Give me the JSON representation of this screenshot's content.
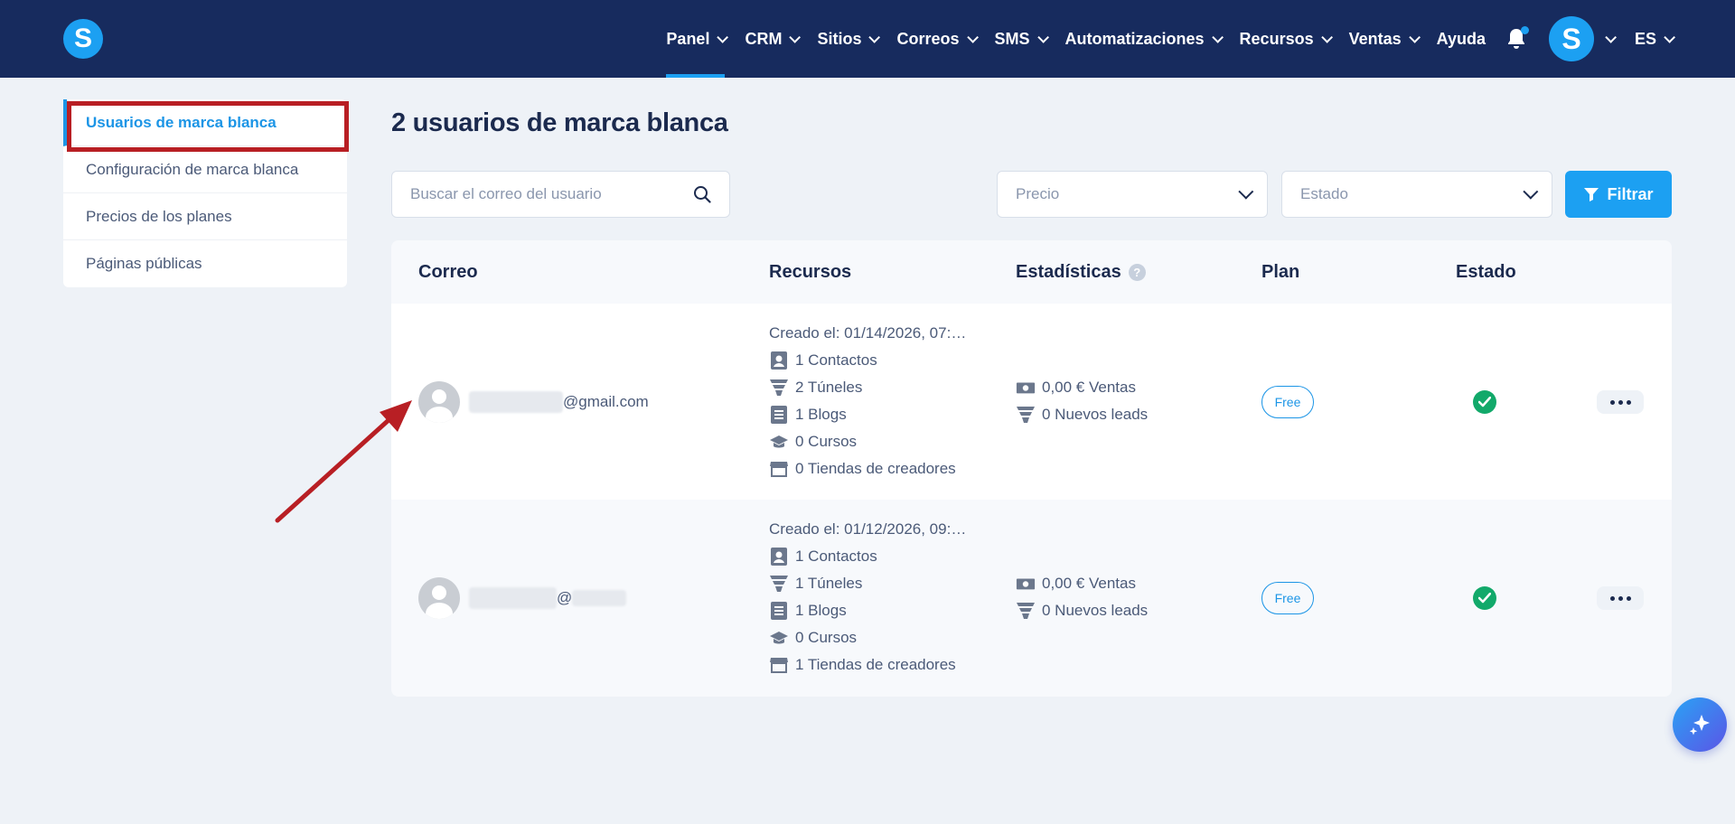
{
  "brand": {
    "logo_letter": "S",
    "accent": "#1ca0f2",
    "nav_bg": "#172b5e"
  },
  "nav": {
    "items": [
      {
        "label": "Panel",
        "active": true,
        "has_dropdown": true
      },
      {
        "label": "CRM",
        "has_dropdown": true
      },
      {
        "label": "Sitios",
        "has_dropdown": true
      },
      {
        "label": "Correos",
        "has_dropdown": true
      },
      {
        "label": "SMS",
        "has_dropdown": true
      },
      {
        "label": "Automatizaciones",
        "has_dropdown": true
      },
      {
        "label": "Recursos",
        "has_dropdown": true
      },
      {
        "label": "Ventas",
        "has_dropdown": true
      },
      {
        "label": "Ayuda",
        "has_dropdown": false
      }
    ],
    "avatar_letter": "S",
    "language": "ES"
  },
  "sidebar": {
    "items": [
      {
        "label": "Usuarios de marca blanca",
        "active": true
      },
      {
        "label": "Configuración de marca blanca"
      },
      {
        "label": "Precios de los planes"
      },
      {
        "label": "Páginas públicas"
      }
    ]
  },
  "main": {
    "title": "2 usuarios de marca blanca",
    "search_placeholder": "Buscar el correo del usuario",
    "price_select": "Precio",
    "status_select": "Estado",
    "filter_button": "Filtrar"
  },
  "table": {
    "headers": {
      "email": "Correo",
      "resources": "Recursos",
      "stats": "Estadísticas",
      "plan": "Plan",
      "status": "Estado"
    },
    "rows": [
      {
        "email": "@gmail.com",
        "created": "Creado el: 01/14/2026, 07:…",
        "contacts": "1 Contactos",
        "funnels": "2 Túneles",
        "blogs": "1 Blogs",
        "courses": "0 Cursos",
        "stores": "0 Tiendas de creadores",
        "sales": "0,00 € Ventas",
        "leads": "0 Nuevos leads",
        "plan": "Free",
        "status": "active"
      },
      {
        "email": "@",
        "created": "Creado el: 01/12/2026, 09:…",
        "contacts": "1 Contactos",
        "funnels": "1 Túneles",
        "blogs": "1 Blogs",
        "courses": "0 Cursos",
        "stores": "1 Tiendas de creadores",
        "sales": "0,00 € Ventas",
        "leads": "0 Nuevos leads",
        "plan": "Free",
        "status": "active"
      }
    ]
  },
  "annotation": {
    "highlight_color": "#b81f24",
    "arrow_color": "#b81f24"
  }
}
